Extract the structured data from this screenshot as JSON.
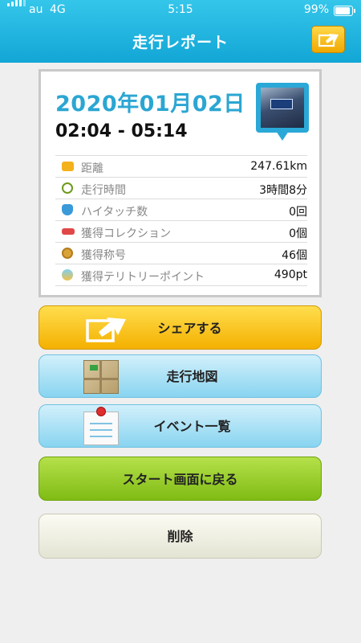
{
  "status": {
    "carrier": "au",
    "network": "4G",
    "time": "5:15",
    "battery": "99%"
  },
  "header": {
    "title": "走行レポート",
    "share_icon": "share-arrow-icon",
    "accent": "#1aa9d9"
  },
  "report": {
    "date": "2020年01月02日",
    "time_range": "02:04 - 05:14",
    "stats": [
      {
        "icon": "km-badge-icon",
        "label": "距離",
        "value": "247.61km"
      },
      {
        "icon": "clock-icon",
        "label": "走行時間",
        "value": "3時間8分"
      },
      {
        "icon": "hand-icon",
        "label": "ハイタッチ数",
        "value": "0回"
      },
      {
        "icon": "car-icon",
        "label": "獲得コレクション",
        "value": "0個"
      },
      {
        "icon": "medal-icon",
        "label": "獲得称号",
        "value": "46個"
      },
      {
        "icon": "territory-icon",
        "label": "獲得テリトリーポイント",
        "value": "490pt"
      }
    ]
  },
  "buttons": {
    "share": "シェアする",
    "map": "走行地図",
    "events": "イベント一覧",
    "back_to_start": "スタート画面に戻る",
    "delete": "削除"
  }
}
